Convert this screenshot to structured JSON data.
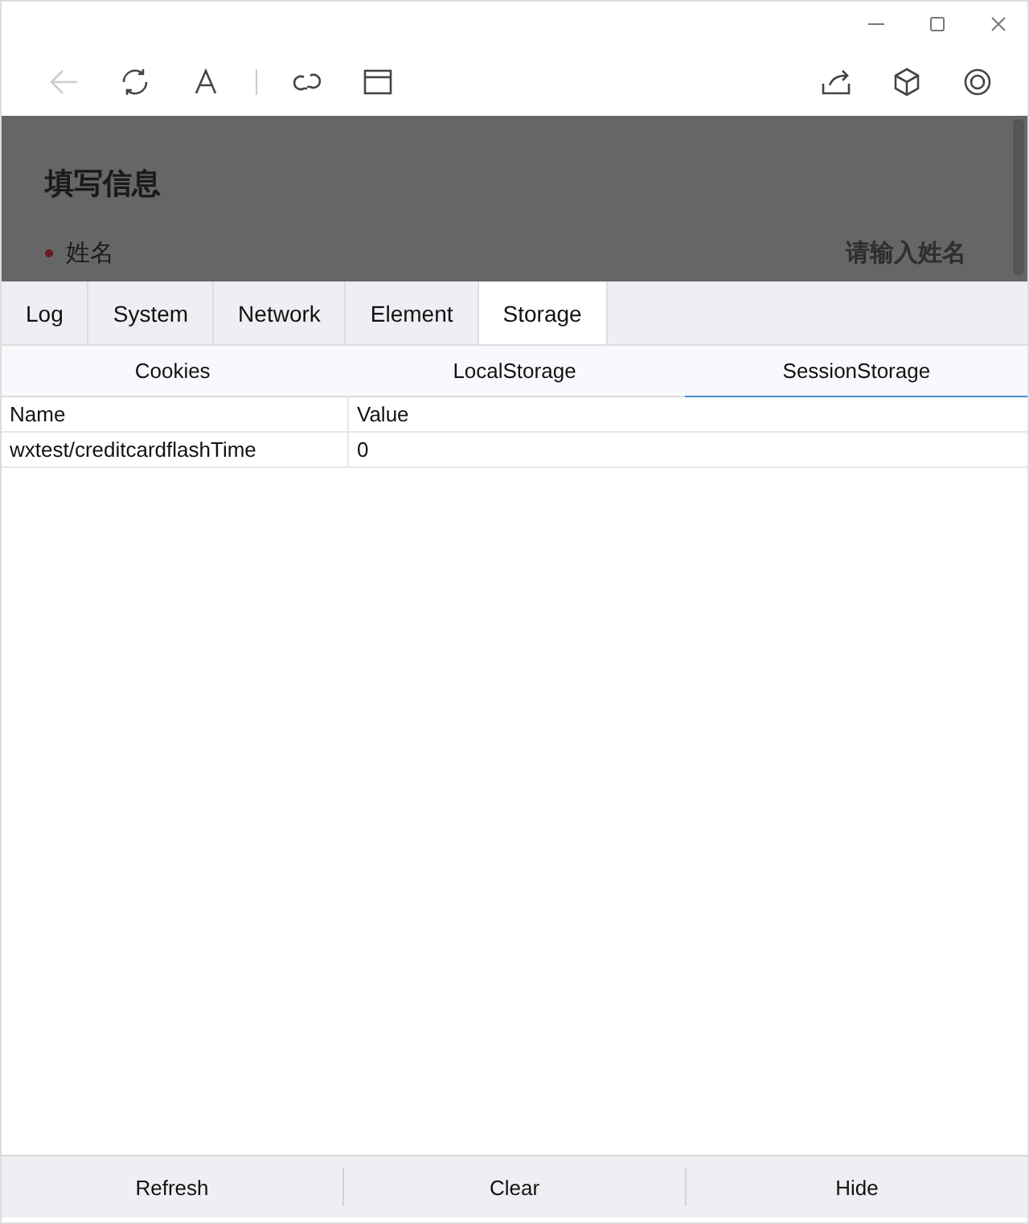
{
  "toolbar": {
    "back": {
      "disabled": true
    }
  },
  "page": {
    "heading": "填写信息",
    "field_label": "姓名",
    "field_placeholder": "请输入姓名"
  },
  "tabs": [
    {
      "label": "Log",
      "selected": false
    },
    {
      "label": "System",
      "selected": false
    },
    {
      "label": "Network",
      "selected": false
    },
    {
      "label": "Element",
      "selected": false
    },
    {
      "label": "Storage",
      "selected": true
    }
  ],
  "subtabs": [
    {
      "label": "Cookies",
      "selected": false
    },
    {
      "label": "LocalStorage",
      "selected": false
    },
    {
      "label": "SessionStorage",
      "selected": true
    }
  ],
  "table": {
    "columns": [
      "Name",
      "Value"
    ],
    "rows": [
      [
        "wxtest/creditcardflashTime",
        "0"
      ]
    ]
  },
  "buttons": [
    "Refresh",
    "Clear",
    "Hide"
  ]
}
